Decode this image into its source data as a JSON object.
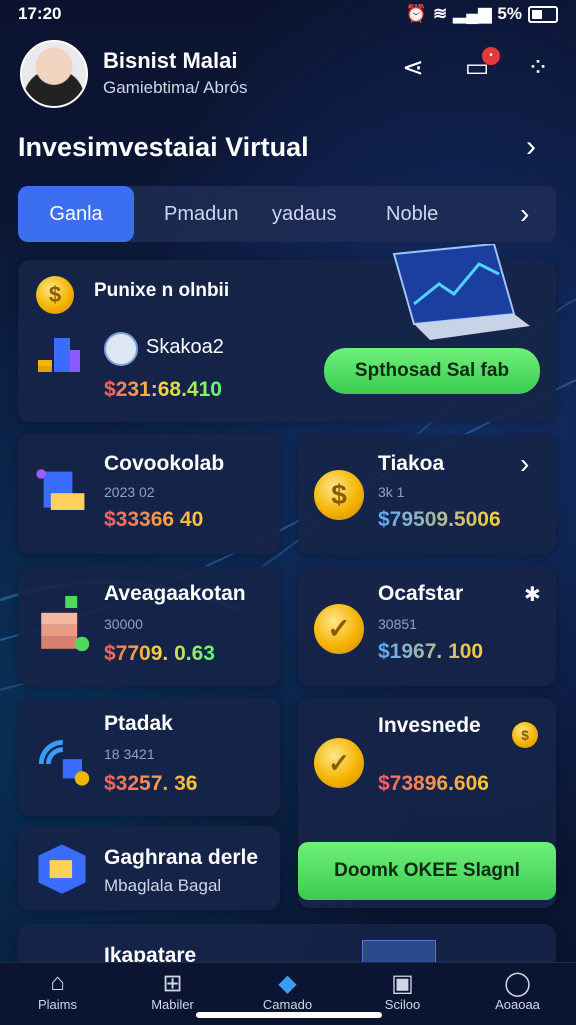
{
  "status": {
    "time": "17:20",
    "battery": "5%"
  },
  "profile": {
    "name": "Bisnist Malai",
    "subtitle": "Gamiebtima/ Abrós"
  },
  "section": {
    "title": "Invesimvestaiai Virtual"
  },
  "tabs": [
    "Ganla",
    "Pmadun",
    "yadaus",
    "Noble"
  ],
  "hero": {
    "title": "Punixe n olnbii",
    "asset": "Skakoa2",
    "amount": "$231:68.410",
    "button": "Spthosad Sal fab"
  },
  "cards": [
    {
      "title": "Covookolab",
      "sub": "2023 02",
      "amount": "$33366 40"
    },
    {
      "title": "Tiakoa",
      "sub": "3k 1",
      "amount": "$79509.5006"
    },
    {
      "title": "Aveagaakotan",
      "sub": "30000",
      "amount": "$7709. 0.63"
    },
    {
      "title": "Ocafstar",
      "sub": "30851",
      "amount": "$1967. 100"
    },
    {
      "title": "Ptadak",
      "sub": "18 3421",
      "amount": "$3257. 36"
    },
    {
      "title": "Invesnede",
      "sub": "",
      "amount": "$73896.606"
    }
  ],
  "wide_card": {
    "title": "Gaghrana derle",
    "sub": "Mbaglala Bagal"
  },
  "green_button": "Doomk OKEE Slagnl",
  "partial_card": {
    "title": "Ikapatare"
  },
  "nav": [
    {
      "label": "Plaims",
      "icon": "home-icon"
    },
    {
      "label": "Mabiler",
      "icon": "grid-icon"
    },
    {
      "label": "Camado",
      "icon": "cube-icon"
    },
    {
      "label": "Sciloo",
      "icon": "mailbox-icon"
    },
    {
      "label": "Aoaoaa",
      "icon": "person-icon"
    }
  ],
  "colors": {
    "accent": "#3b6ff0",
    "green": "#4fd95e",
    "badge": "#e5393d"
  }
}
